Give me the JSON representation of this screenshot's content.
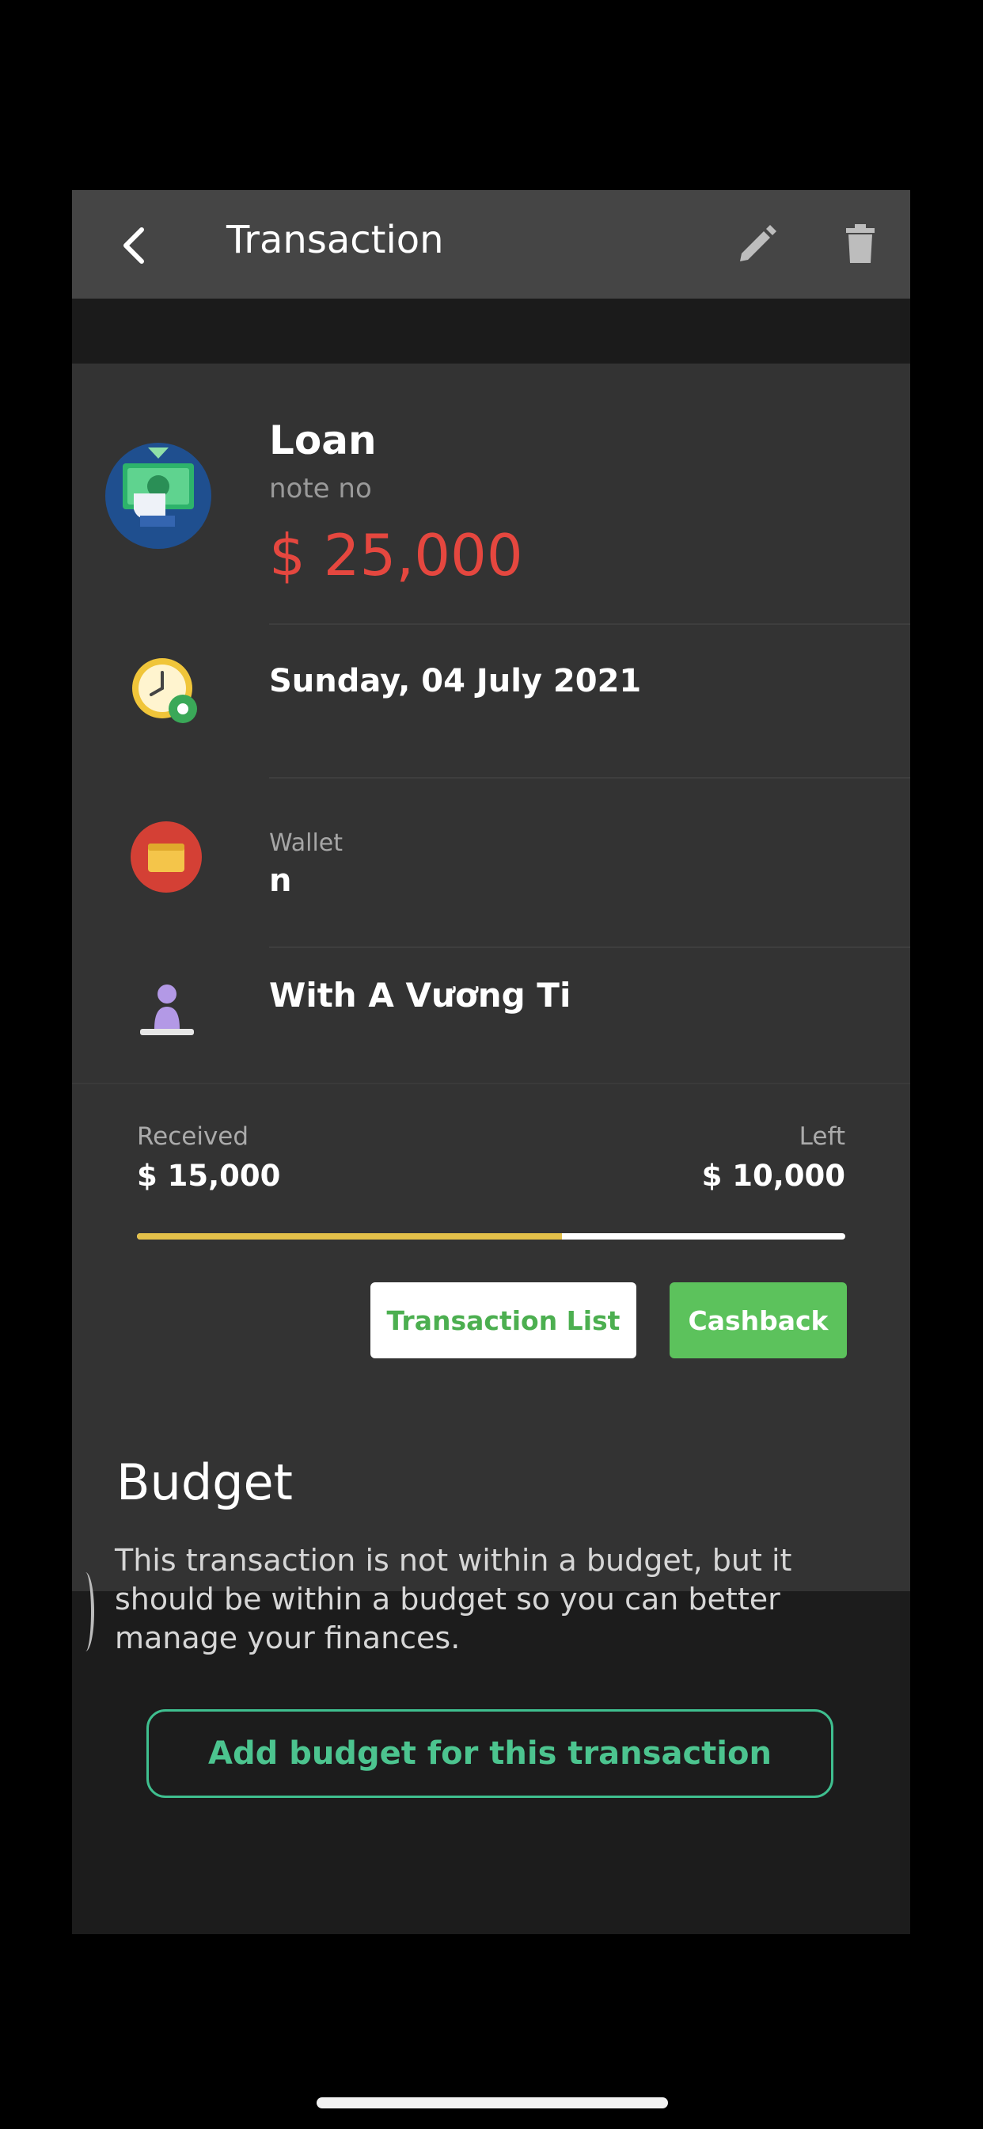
{
  "header": {
    "title": "Transaction",
    "back_icon": "chevron-left-icon",
    "edit_icon": "pencil-icon",
    "delete_icon": "trash-icon"
  },
  "transaction": {
    "category": "Loan",
    "note": "note no",
    "amount": "$ 25,000",
    "category_icon": "money-loan-icon",
    "date": "Sunday, 04 July 2021",
    "date_icon": "clock-gear-icon",
    "wallet_label": "Wallet",
    "wallet_name": "n",
    "wallet_icon": "wallet-icon",
    "with": "With A Vương Ti",
    "with_icon": "person-icon"
  },
  "repayment": {
    "received_label": "Received",
    "received_value": "$ 15,000",
    "left_label": "Left",
    "left_value": "$ 10,000",
    "progress_fraction": 0.6,
    "transaction_list_label": "Transaction List",
    "cashback_label": "Cashback"
  },
  "budget": {
    "title": "Budget",
    "text": "This transaction is not within a budget, but it should be within a budget so you can better manage your finances.",
    "add_button_label": "Add budget for this transaction"
  },
  "colors": {
    "amount": "#e5473f",
    "accent_green": "#5cc25c",
    "outline_teal": "#3fbf8f",
    "progress": "#e3c04a"
  }
}
